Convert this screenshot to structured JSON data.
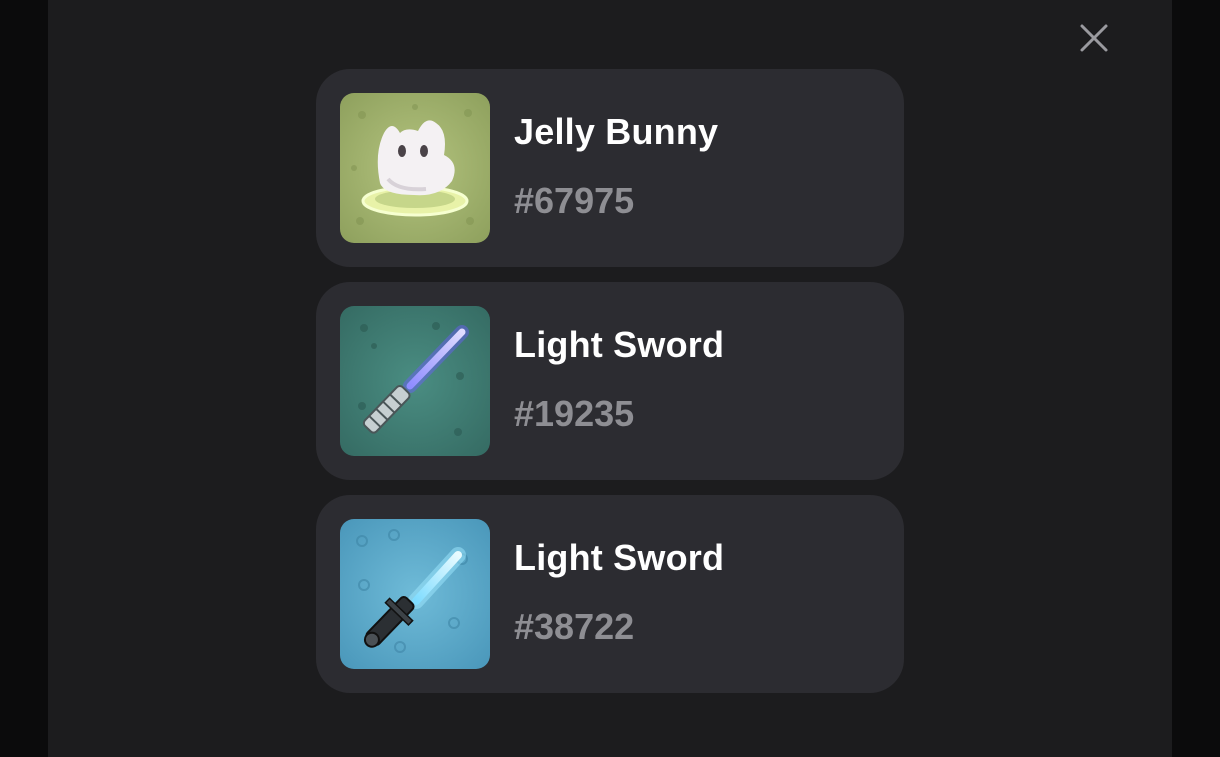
{
  "modal": {
    "close_icon": "close-icon"
  },
  "items": [
    {
      "name": "Jelly Bunny",
      "number": "#67975",
      "icon": "jelly-bunny-icon",
      "bg": "#9caf6a"
    },
    {
      "name": "Light Sword",
      "number": "#19235",
      "icon": "light-sword-icon",
      "bg": "#3f7d74"
    },
    {
      "name": "Light Sword",
      "number": "#38722",
      "icon": "light-sword-icon",
      "bg": "#5fa9c9"
    }
  ],
  "colors": {
    "backdrop": "#0b0b0c",
    "modal_bg": "#1c1c1e",
    "card_bg": "#2c2c31",
    "title": "#ffffff",
    "number": "#8e8e93"
  }
}
